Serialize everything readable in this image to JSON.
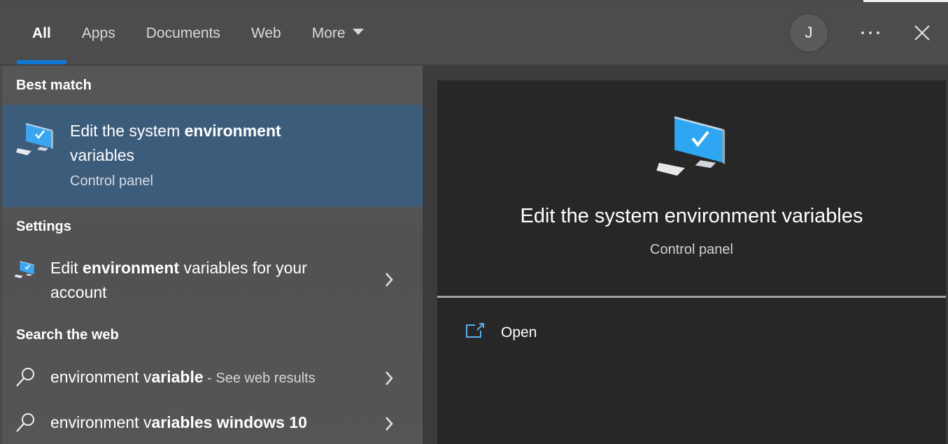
{
  "header": {
    "tabs": [
      {
        "label": "All",
        "active": true
      },
      {
        "label": "Apps",
        "active": false
      },
      {
        "label": "Documents",
        "active": false
      },
      {
        "label": "Web",
        "active": false
      },
      {
        "label": "More",
        "active": false,
        "has_dropdown": true
      }
    ],
    "avatar_initial": "J",
    "more_options_icon": "ellipsis-icon",
    "close_icon": "close-icon",
    "accent_color": "#0f78d4"
  },
  "results": {
    "best_match": {
      "section_label": "Best match",
      "title_regular": "Edit the system ",
      "title_bold": "environment",
      "title_line2": "variables",
      "subtitle": "Control panel",
      "icon": "computer-check-icon",
      "selected_color": "#3c5c7b"
    },
    "settings": {
      "section_label": "Settings",
      "items": [
        {
          "text_pre": "Edit ",
          "text_bold": "environment",
          "text_post": " variables for your",
          "text_line2": "account",
          "icon": "computer-check-icon"
        }
      ]
    },
    "web": {
      "section_label": "Search the web",
      "items": [
        {
          "text_pre": "environment v",
          "text_bold": "ariable",
          "suffix": " - See web results",
          "icon": "search-icon"
        },
        {
          "text_pre": "environment v",
          "text_bold": "ariables windows 10",
          "suffix": "",
          "icon": "search-icon"
        }
      ]
    }
  },
  "preview": {
    "title": "Edit the system environment variables",
    "subtitle": "Control panel",
    "icon": "computer-check-icon",
    "actions": [
      {
        "label": "Open",
        "icon": "open-external-icon"
      }
    ]
  }
}
